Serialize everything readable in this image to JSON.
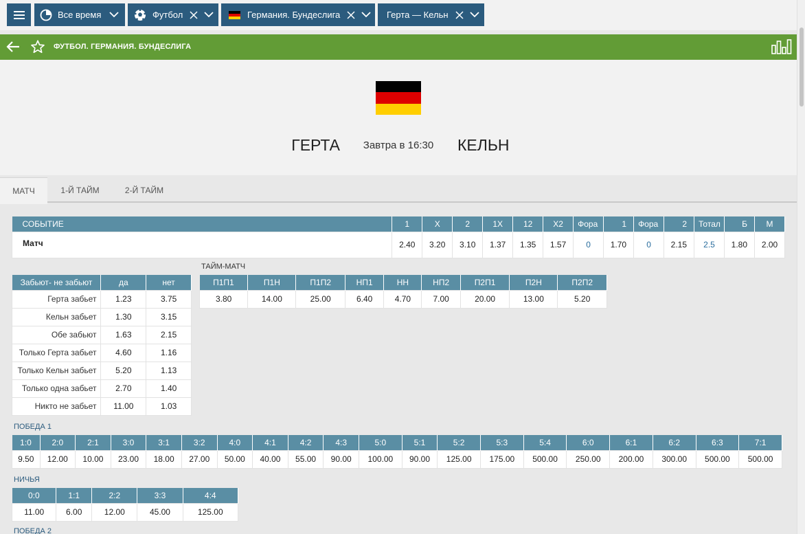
{
  "filters": {
    "time": "Все время",
    "sport": "Футбол",
    "league": "Германия. Бундеслига",
    "match": "Герта — Кельн"
  },
  "header": {
    "breadcrumb": "ФУТБОЛ. ГЕРМАНИЯ. БУНДЕСЛИГА"
  },
  "match": {
    "team1": "ГЕРТА",
    "time": "Завтра в 16:30",
    "team2": "КЕЛЬН",
    "flag_colors": [
      "#000000",
      "#dd0000",
      "#ffce00"
    ]
  },
  "tabs": [
    "МАТЧ",
    "1-Й ТАЙМ",
    "2-Й ТАЙМ"
  ],
  "event_table": {
    "headers": {
      "event": "СОБЫТИЕ",
      "c1": "1",
      "cx": "X",
      "c2": "2",
      "c1x": "1X",
      "c12": "12",
      "cx2": "X2",
      "fora1": "Фора",
      "fora1v": "1",
      "fora2": "Фора",
      "fora2v": "2",
      "total": "Тотал",
      "b": "Б",
      "m": "М"
    },
    "row": {
      "event": "Матч",
      "c1": "2.40",
      "cx": "3.20",
      "c2": "3.10",
      "c1x": "1.37",
      "c12": "1.35",
      "cx2": "1.57",
      "fora1": "0",
      "fora1v": "1.70",
      "fora2": "0",
      "fora2v": "2.15",
      "total": "2.5",
      "b": "1.80",
      "m": "2.00"
    }
  },
  "score_table": {
    "headers": [
      "Забьют- не забьют",
      "да",
      "нет"
    ],
    "rows": [
      [
        "Герта забьет",
        "1.23",
        "3.75"
      ],
      [
        "Кельн забьет",
        "1.30",
        "3.15"
      ],
      [
        "Обе забьют",
        "1.63",
        "2.15"
      ],
      [
        "Только Герта забьет",
        "4.60",
        "1.16"
      ],
      [
        "Только Кельн забьет",
        "5.20",
        "1.13"
      ],
      [
        "Только одна забьет",
        "2.70",
        "1.40"
      ],
      [
        "Никто не забьет",
        "11.00",
        "1.03"
      ]
    ]
  },
  "halftime": {
    "label": "ТАЙМ-МАТЧ",
    "headers": [
      "П1П1",
      "П1Н",
      "П1П2",
      "НП1",
      "НН",
      "НП2",
      "П2П1",
      "П2Н",
      "П2П2"
    ],
    "values": [
      "3.80",
      "14.00",
      "25.00",
      "6.40",
      "4.70",
      "7.00",
      "20.00",
      "13.00",
      "5.20"
    ]
  },
  "win1": {
    "label": "ПОБЕДА 1",
    "headers": [
      "1:0",
      "2:0",
      "2:1",
      "3:0",
      "3:1",
      "3:2",
      "4:0",
      "4:1",
      "4:2",
      "4:3",
      "5:0",
      "5:1",
      "5:2",
      "5:3",
      "5:4",
      "6:0",
      "6:1",
      "6:2",
      "6:3",
      "7:1"
    ],
    "values": [
      "9.50",
      "12.00",
      "10.00",
      "23.00",
      "18.00",
      "27.00",
      "50.00",
      "40.00",
      "55.00",
      "90.00",
      "100.00",
      "90.00",
      "125.00",
      "175.00",
      "500.00",
      "250.00",
      "200.00",
      "300.00",
      "500.00",
      "500.00"
    ]
  },
  "draw": {
    "label": "НИЧЬЯ",
    "headers": [
      "0:0",
      "1:1",
      "2:2",
      "3:3",
      "4:4"
    ],
    "values": [
      "11.00",
      "6.00",
      "12.00",
      "45.00",
      "125.00"
    ]
  },
  "win2": {
    "label": "ПОБЕДА 2"
  },
  "colors": {
    "chip_bg": "#2b5b7e",
    "green_bar": "#629c36",
    "table_header": "#5a8ea4",
    "link": "#2b6e9e"
  }
}
